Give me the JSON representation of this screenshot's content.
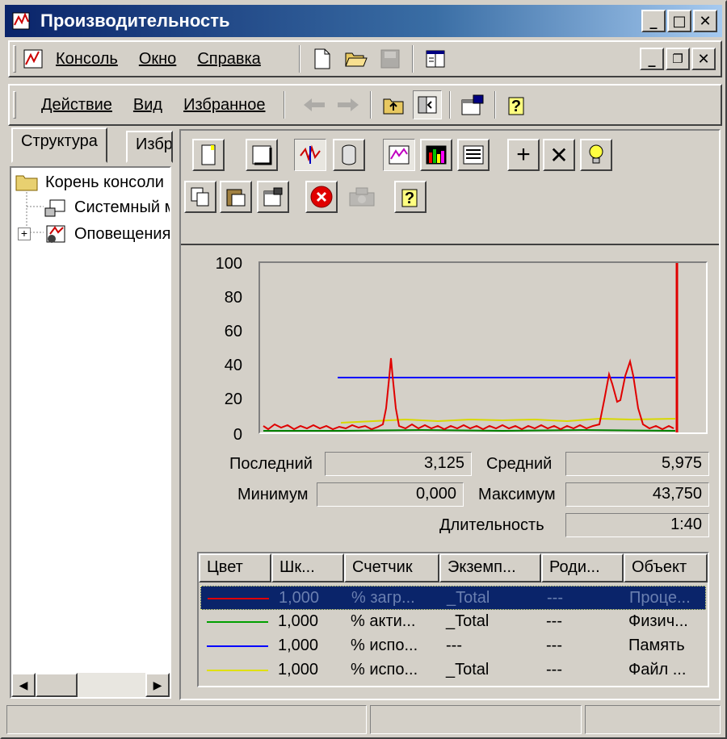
{
  "window": {
    "title": "Производительность"
  },
  "menu": {
    "items": [
      "Консоль",
      "Окно",
      "Справка"
    ]
  },
  "action_menu": {
    "items": [
      "Действие",
      "Вид",
      "Избранное"
    ]
  },
  "left_tabs": [
    "Структура",
    "Избр"
  ],
  "tree": {
    "root": "Корень консоли",
    "items": [
      "Системный монитор",
      "Оповещения"
    ]
  },
  "graph": {
    "y_ticks": [
      "100",
      "80",
      "60",
      "40",
      "20",
      "0"
    ],
    "colors": {
      "red": "#e00000",
      "green": "#008000",
      "blue": "#0000ff",
      "yellow": "#e0e000"
    }
  },
  "stats": {
    "last_label": "Последний",
    "last_value": "3,125",
    "avg_label": "Средний",
    "avg_value": "5,975",
    "min_label": "Минимум",
    "min_value": "0,000",
    "max_label": "Максимум",
    "max_value": "43,750",
    "dur_label": "Длительность",
    "dur_value": "1:40"
  },
  "counters": {
    "headers": [
      "Цвет",
      "Шк...",
      "Счетчик",
      "Экземп...",
      "Роди...",
      "Объект"
    ],
    "rows": [
      {
        "color": "#e00000",
        "scale": "1,000",
        "counter": "% загр...",
        "instance": "_Total",
        "parent": "---",
        "object": "Проце..."
      },
      {
        "color": "#00a000",
        "scale": "1,000",
        "counter": "% акти...",
        "instance": "_Total",
        "parent": "---",
        "object": "Физич..."
      },
      {
        "color": "#0000ff",
        "scale": "1,000",
        "counter": "% испо...",
        "instance": "---",
        "parent": "---",
        "object": "Память"
      },
      {
        "color": "#e0e000",
        "scale": "1,000",
        "counter": "% испо...",
        "instance": "_Total",
        "parent": "---",
        "object": "Файл ..."
      }
    ]
  }
}
